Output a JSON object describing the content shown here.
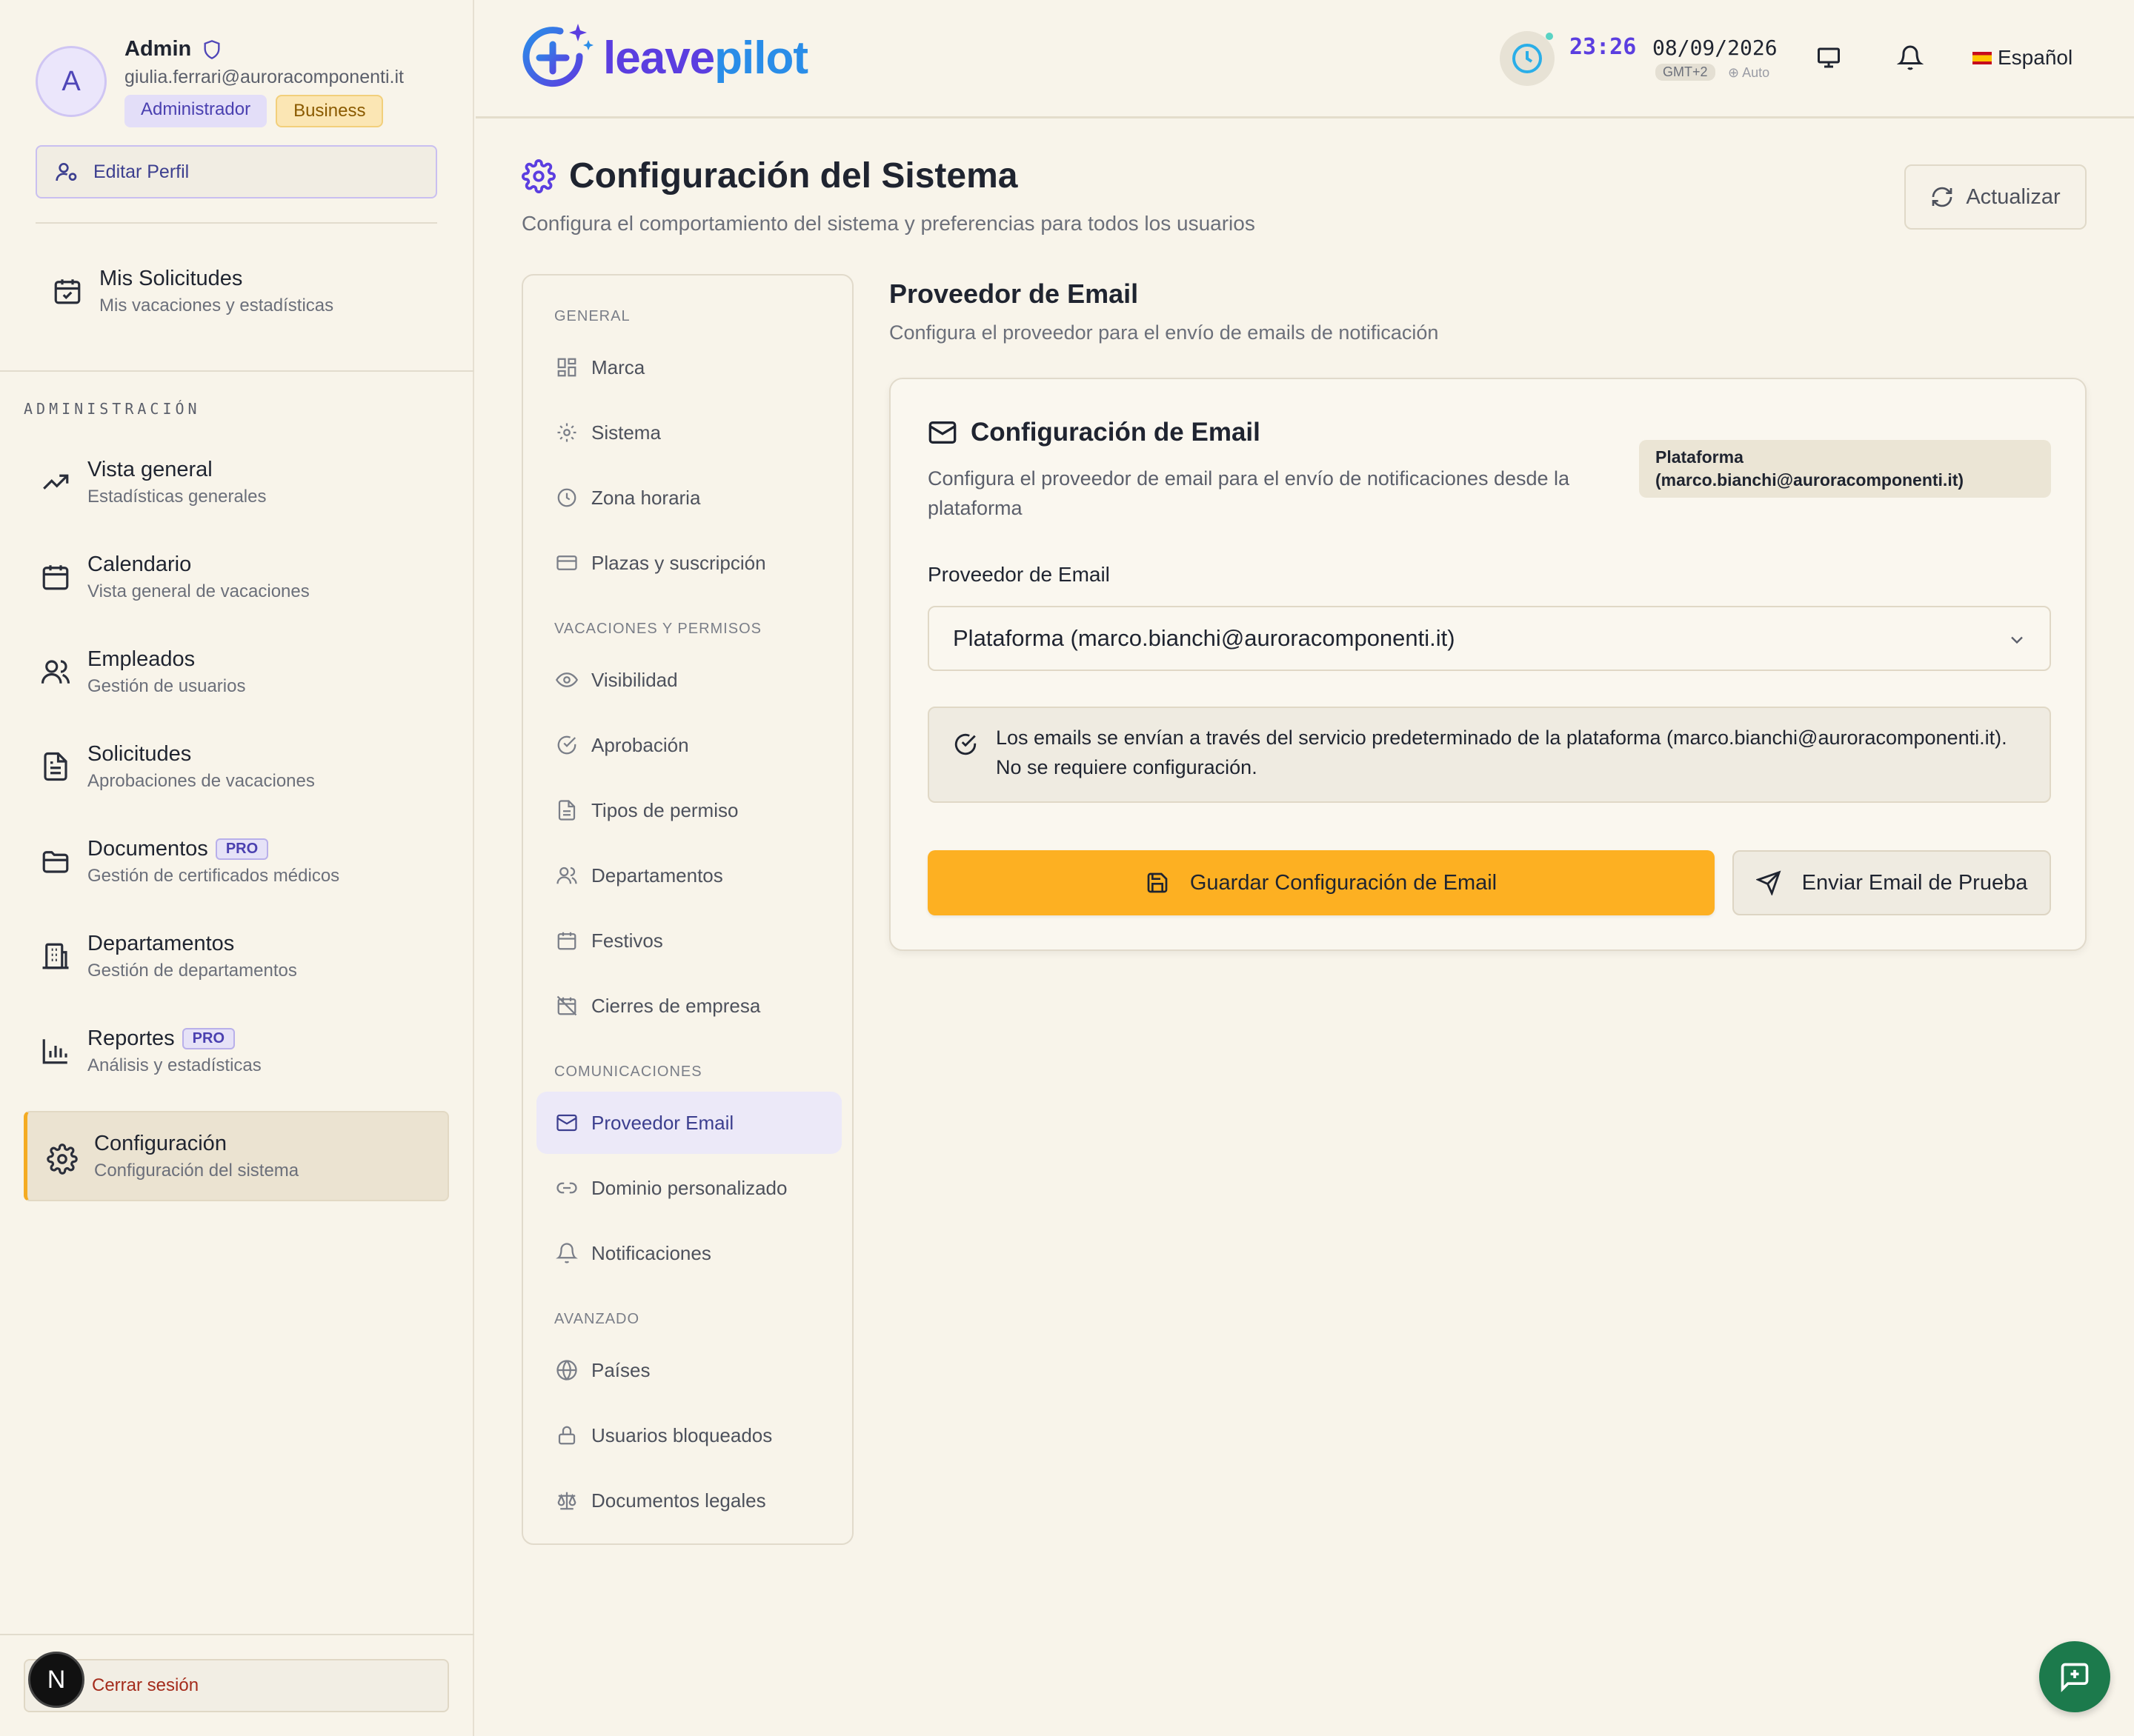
{
  "profile": {
    "avatar_letter": "A",
    "name": "Admin",
    "email": "giulia.ferrari@auroracomponenti.it",
    "role_badge": "Administrador",
    "plan_badge": "Business",
    "edit_profile_label": "Editar Perfil"
  },
  "my_requests": {
    "title": "Mis Solicitudes",
    "subtitle": "Mis vacaciones y estadísticas"
  },
  "admin_section_label": "ADMINISTRACIÓN",
  "nav": [
    {
      "title": "Vista general",
      "subtitle": "Estadísticas generales",
      "icon": "trending-up-icon"
    },
    {
      "title": "Calendario",
      "subtitle": "Vista general de vacaciones",
      "icon": "calendar-icon"
    },
    {
      "title": "Empleados",
      "subtitle": "Gestión de usuarios",
      "icon": "users-icon"
    },
    {
      "title": "Solicitudes",
      "subtitle": "Aprobaciones de vacaciones",
      "icon": "file-text-icon"
    },
    {
      "title": "Documentos",
      "subtitle": "Gestión de certificados médicos",
      "icon": "folder-icon",
      "tag": "PRO"
    },
    {
      "title": "Departamentos",
      "subtitle": "Gestión de departamentos",
      "icon": "building-icon"
    },
    {
      "title": "Reportes",
      "subtitle": "Análisis y estadísticas",
      "icon": "bar-chart-icon",
      "tag": "PRO"
    },
    {
      "title": "Configuración",
      "subtitle": "Configuración del sistema",
      "icon": "gear-icon",
      "active": true
    }
  ],
  "logout_label": "Cerrar sesión",
  "logout_avatar_letter": "N",
  "topbar": {
    "logo_leave": "leave",
    "logo_pilot": "pilot",
    "time": "23:26",
    "date": "08/09/2026",
    "timezone": "GMT+2",
    "tz_mode": "⊕ Auto",
    "language": "Español"
  },
  "page": {
    "title": "Configuración del Sistema",
    "subtitle": "Configura el comportamiento del sistema y preferencias para todos los usuarios",
    "refresh_label": "Actualizar"
  },
  "settings_nav": {
    "sections": [
      "GENERAL",
      "VACACIONES Y PERMISOS",
      "COMUNICACIONES",
      "AVANZADO"
    ],
    "items": [
      "Marca",
      "Sistema",
      "Zona horaria",
      "Plazas y suscripción",
      "Visibilidad",
      "Aprobación",
      "Tipos de permiso",
      "Departamentos",
      "Festivos",
      "Cierres de empresa",
      "Proveedor Email",
      "Dominio personalizado",
      "Notificaciones",
      "Países",
      "Usuarios bloqueados",
      "Documentos legales"
    ],
    "active_item": "Proveedor Email"
  },
  "email_provider": {
    "section_title": "Proveedor de Email",
    "section_subtitle": "Configura el proveedor para el envío de emails de notificación",
    "card_title": "Configuración de Email",
    "card_description": "Configura el proveedor de email para el envío de notificaciones desde la plataforma",
    "current_badge": "Plataforma (marco.bianchi@auroracomponenti.it)",
    "field_label": "Proveedor de Email",
    "selected_value": "Plataforma (marco.bianchi@auroracomponenti.it)",
    "info_text": "Los emails se envían a través del servicio predeterminado de la plataforma (marco.bianchi@auroracomponenti.it). No se requiere configuración.",
    "save_label": "Guardar Configuración de Email",
    "test_label": "Enviar Email de Prueba"
  },
  "colors": {
    "accent": "#5b3ee0",
    "primary_button": "#fdb022",
    "active_border": "#f4ab22",
    "fab": "#1c7a4c",
    "background": "#f8f4ea"
  }
}
